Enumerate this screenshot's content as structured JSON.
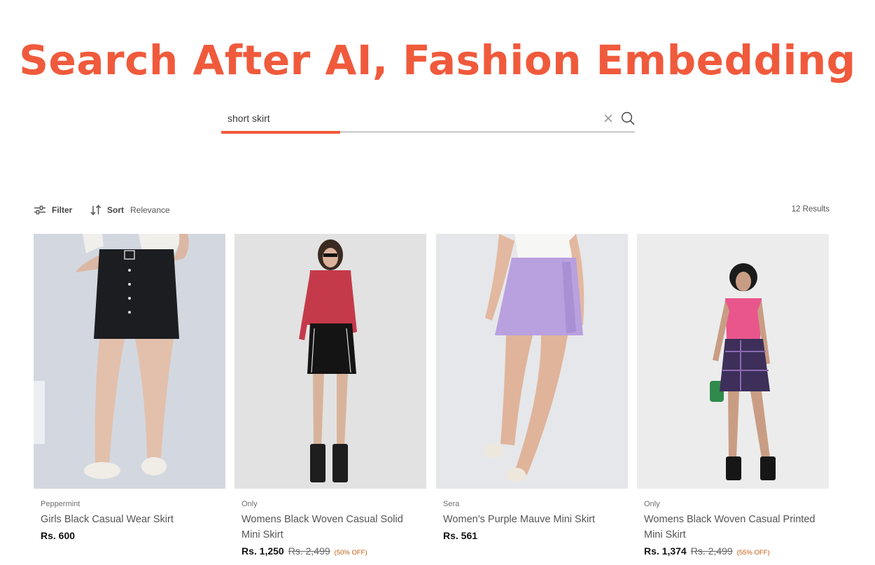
{
  "headline": "Search After AI, Fashion Embedding",
  "search": {
    "value": "short skirt"
  },
  "toolbar": {
    "filter_label": "Filter",
    "sort_label": "Sort",
    "sort_value": "Relevance",
    "results_text": "12 Results"
  },
  "products": [
    {
      "brand": "Peppermint",
      "name": "Girls Black Casual Wear Skirt",
      "price": "Rs. 600",
      "mrp": "",
      "discount": ""
    },
    {
      "brand": "Only",
      "name": "Womens Black Woven Casual Solid Mini Skirt",
      "price": "Rs. 1,250",
      "mrp": "Rs. 2,499",
      "discount": "(50% OFF)"
    },
    {
      "brand": "Sera",
      "name": "Women’s Purple Mauve Mini Skirt",
      "price": "Rs. 561",
      "mrp": "",
      "discount": ""
    },
    {
      "brand": "Only",
      "name": "Womens Black Woven Casual Printed Mini Skirt",
      "price": "Rs. 1,374",
      "mrp": "Rs. 2,499",
      "discount": "(55% OFF)"
    }
  ],
  "colors": {
    "accent": "#f05a3c",
    "discount": "#c25a12"
  }
}
